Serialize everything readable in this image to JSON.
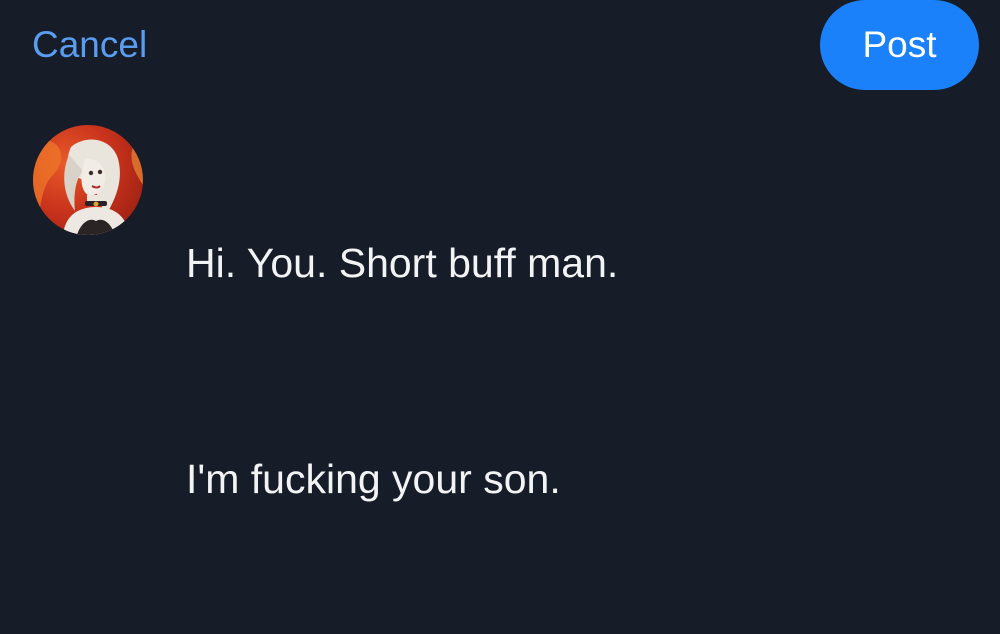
{
  "header": {
    "cancel_label": "Cancel",
    "post_label": "Post"
  },
  "composer": {
    "lines": [
      "Hi. You. Short buff man.",
      "I'm fucking your son."
    ]
  },
  "colors": {
    "background": "#161c28",
    "accent": "#1a81fa",
    "cancel_text": "#5a9cf0",
    "body_text": "#f2f3f5"
  },
  "icons": {
    "avatar": "user-avatar-illustration"
  }
}
